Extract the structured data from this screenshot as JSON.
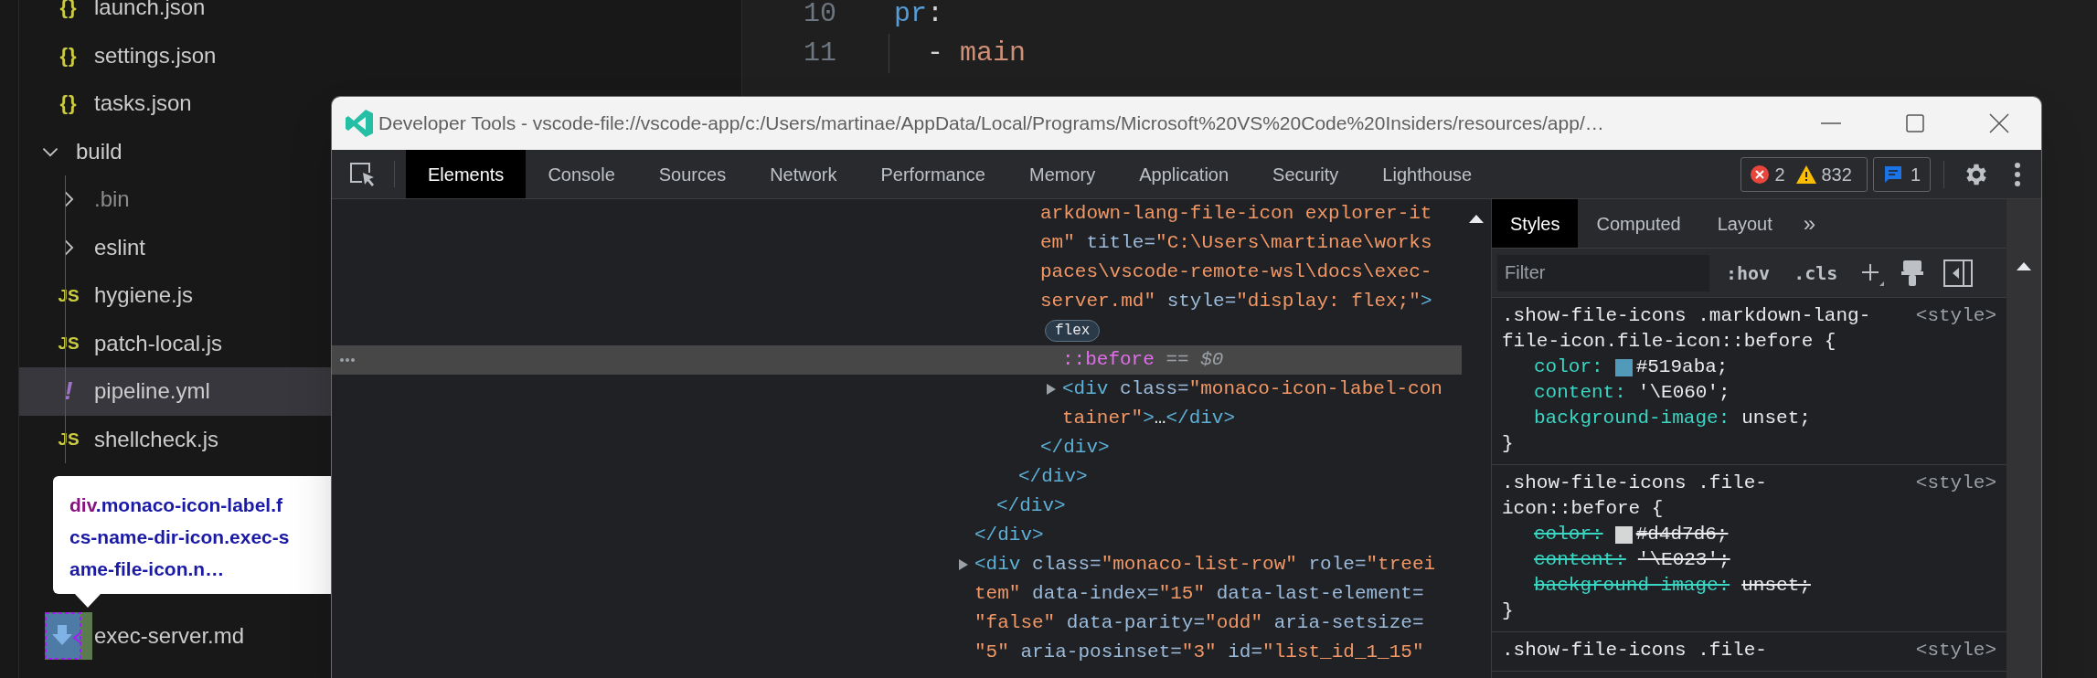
{
  "explorer": {
    "items": [
      {
        "children": [
          {
            "name": "launch.json",
            "kind": "json",
            "icon": "{}",
            "selected": false
          },
          {
            "name": "settings.json",
            "kind": "json",
            "icon": "{}",
            "selected": false
          },
          {
            "name": "tasks.json",
            "kind": "json",
            "icon": "{}",
            "selected": false
          }
        ]
      },
      {
        "name": "build",
        "kind": "folder",
        "expanded": true,
        "dimmed": false,
        "selected": false,
        "children": [
          {
            "name": ".bin",
            "kind": "folder",
            "expanded": false,
            "dimmed": true,
            "selected": false
          },
          {
            "name": "eslint",
            "kind": "folder",
            "expanded": false,
            "dimmed": false,
            "selected": false
          },
          {
            "name": "hygiene.js",
            "kind": "js",
            "icon": "JS",
            "selected": false
          },
          {
            "name": "patch-local.js",
            "kind": "js",
            "icon": "JS",
            "selected": false
          },
          {
            "name": "pipeline.yml",
            "kind": "yaml",
            "icon": "!",
            "selected": true
          },
          {
            "name": "shellcheck.js",
            "kind": "js",
            "icon": "JS",
            "selected": false
          }
        ]
      },
      {
        "children": [
          {
            "name": "exec-server.md",
            "kind": "markdown",
            "selected": false
          }
        ]
      }
    ]
  },
  "tooltip": {
    "lines": [
      [
        {
          "kind": "tag",
          "text": "div"
        },
        {
          "kind": "class",
          "text": ".monaco-icon-label.f"
        }
      ],
      [
        {
          "kind": "class",
          "text": "cs-name-dir-icon.exec-s"
        }
      ],
      [
        {
          "kind": "class",
          "text": "ame-file-icon.n…"
        }
      ]
    ]
  },
  "editor": {
    "lines": [
      {
        "number": "10",
        "indent_guide": false,
        "tokens": [
          {
            "kind": "key",
            "text": "pr"
          },
          {
            "kind": "plain",
            "text": ":"
          }
        ]
      },
      {
        "number": "11",
        "indent_guide": true,
        "tokens": [
          {
            "kind": "plain",
            "text": "  - "
          },
          {
            "kind": "string",
            "text": "main"
          }
        ]
      }
    ]
  },
  "devtools": {
    "title": "Developer Tools - vscode-file://vscode-app/c:/Users/martinae/AppData/Local/Programs/Microsoft%20VS%20Code%20Insiders/resources/app/…",
    "tabs": [
      {
        "label": "Elements",
        "selected": true
      },
      {
        "label": "Console",
        "selected": false
      },
      {
        "label": "Sources",
        "selected": false
      },
      {
        "label": "Network",
        "selected": false
      },
      {
        "label": "Performance",
        "selected": false
      },
      {
        "label": "Memory",
        "selected": false
      },
      {
        "label": "Application",
        "selected": false
      },
      {
        "label": "Security",
        "selected": false
      },
      {
        "label": "Lighthouse",
        "selected": false
      }
    ],
    "issues": [
      {
        "kind": "error",
        "count": "2"
      },
      {
        "kind": "warning",
        "count": "832"
      }
    ],
    "messages": "1",
    "elements": {
      "nodes": [
        {
          "close": "</div>",
          "children": [
            {
              "close": "</div>",
              "children": [
                {
                  "close": "</div>",
                  "children": [
                    {
                      "selected": false,
                      "badge": "flex",
                      "close": "</div>",
                      "lines": [
                        [
                          {
                            "kind": "value",
                            "text": "arkdown-lang-file-icon explorer-it"
                          }
                        ],
                        [
                          {
                            "kind": "value",
                            "text": "em\""
                          },
                          {
                            "kind": "attr",
                            "text": " title="
                          },
                          {
                            "kind": "value",
                            "text": "\"C:\\Users\\martinae\\works"
                          }
                        ],
                        [
                          {
                            "kind": "value",
                            "text": "paces\\vscode-remote-wsl\\docs\\exec-"
                          }
                        ],
                        [
                          {
                            "kind": "value",
                            "text": "server.md\""
                          },
                          {
                            "kind": "attr",
                            "text": " style="
                          },
                          {
                            "kind": "value",
                            "text": "\"display: flex;\""
                          },
                          {
                            "kind": "tag",
                            "text": ">"
                          }
                        ]
                      ],
                      "children": [
                        {
                          "selected": true,
                          "lines": [
                            [
                              {
                                "kind": "pseudo",
                                "text": "::before"
                              },
                              {
                                "kind": "hint",
                                "text": " == $0"
                              }
                            ]
                          ]
                        },
                        {
                          "selected": false,
                          "expanded": false,
                          "lines": [
                            [
                              {
                                "kind": "tag",
                                "text": "<div"
                              },
                              {
                                "kind": "attr",
                                "text": " class="
                              },
                              {
                                "kind": "value",
                                "text": "\"monaco-icon-label-con"
                              }
                            ],
                            [
                              {
                                "kind": "value",
                                "text": "tainer\""
                              },
                              {
                                "kind": "tag",
                                "text": ">"
                              },
                              {
                                "kind": "plain",
                                "text": "…"
                              },
                              {
                                "kind": "tag",
                                "text": "</div>"
                              }
                            ]
                          ]
                        }
                      ]
                    }
                  ]
                }
              ]
            }
          ]
        },
        {
          "selected": false,
          "expanded": false,
          "lines": [
            [
              {
                "kind": "tag",
                "text": "<div"
              },
              {
                "kind": "attr",
                "text": " class="
              },
              {
                "kind": "value",
                "text": "\"monaco-list-row\""
              },
              {
                "kind": "attr",
                "text": " role="
              },
              {
                "kind": "value",
                "text": "\"treei"
              }
            ],
            [
              {
                "kind": "value",
                "text": "tem\""
              },
              {
                "kind": "attr",
                "text": " data-index="
              },
              {
                "kind": "value",
                "text": "\"15\""
              },
              {
                "kind": "attr",
                "text": " data-last-element="
              }
            ],
            [
              {
                "kind": "value",
                "text": "\"false\""
              },
              {
                "kind": "attr",
                "text": " data-parity="
              },
              {
                "kind": "value",
                "text": "\"odd\""
              },
              {
                "kind": "attr",
                "text": " aria-setsize="
              }
            ],
            [
              {
                "kind": "value",
                "text": "\"5\""
              },
              {
                "kind": "attr",
                "text": " aria-posinset="
              },
              {
                "kind": "value",
                "text": "\"3\""
              },
              {
                "kind": "attr",
                "text": " id="
              },
              {
                "kind": "value",
                "text": "\"list_id_1_15\""
              }
            ]
          ]
        }
      ]
    },
    "styles": {
      "tabs": [
        {
          "label": "Styles",
          "selected": true
        },
        {
          "label": "Computed",
          "selected": false
        },
        {
          "label": "Layout",
          "selected": false
        }
      ],
      "more": "»",
      "filter": {
        "placeholder": "Filter"
      },
      "toggles": [
        ":hov",
        ".cls"
      ],
      "rules": [
        {
          "selector": [
            ".show-file-icons .markdown-lang-",
            "file-icon.file-icon::before {"
          ],
          "source": "<style>",
          "close": "}",
          "properties": [
            {
              "name": "color:",
              "value": "#519aba;",
              "color": "#519aba",
              "overridden": false
            },
            {
              "name": "content:",
              "value": "'\\E060';",
              "overridden": false
            },
            {
              "name": "background-image:",
              "value": "unset;",
              "overridden": false
            }
          ]
        },
        {
          "selector": [
            ".show-file-icons .file-",
            "icon::before {"
          ],
          "source": "<style>",
          "close": "}",
          "properties": [
            {
              "name": "color:",
              "value": "#d4d7d6;",
              "color": "#d4d7d6",
              "overridden": true
            },
            {
              "name": "content:",
              "value": "'\\E023';",
              "overridden": true
            },
            {
              "name": "background-image:",
              "value": "unset;",
              "overridden": true
            }
          ]
        },
        {
          "selector": [
            ".show-file-icons .file-"
          ],
          "source": "<style>"
        }
      ]
    }
  }
}
